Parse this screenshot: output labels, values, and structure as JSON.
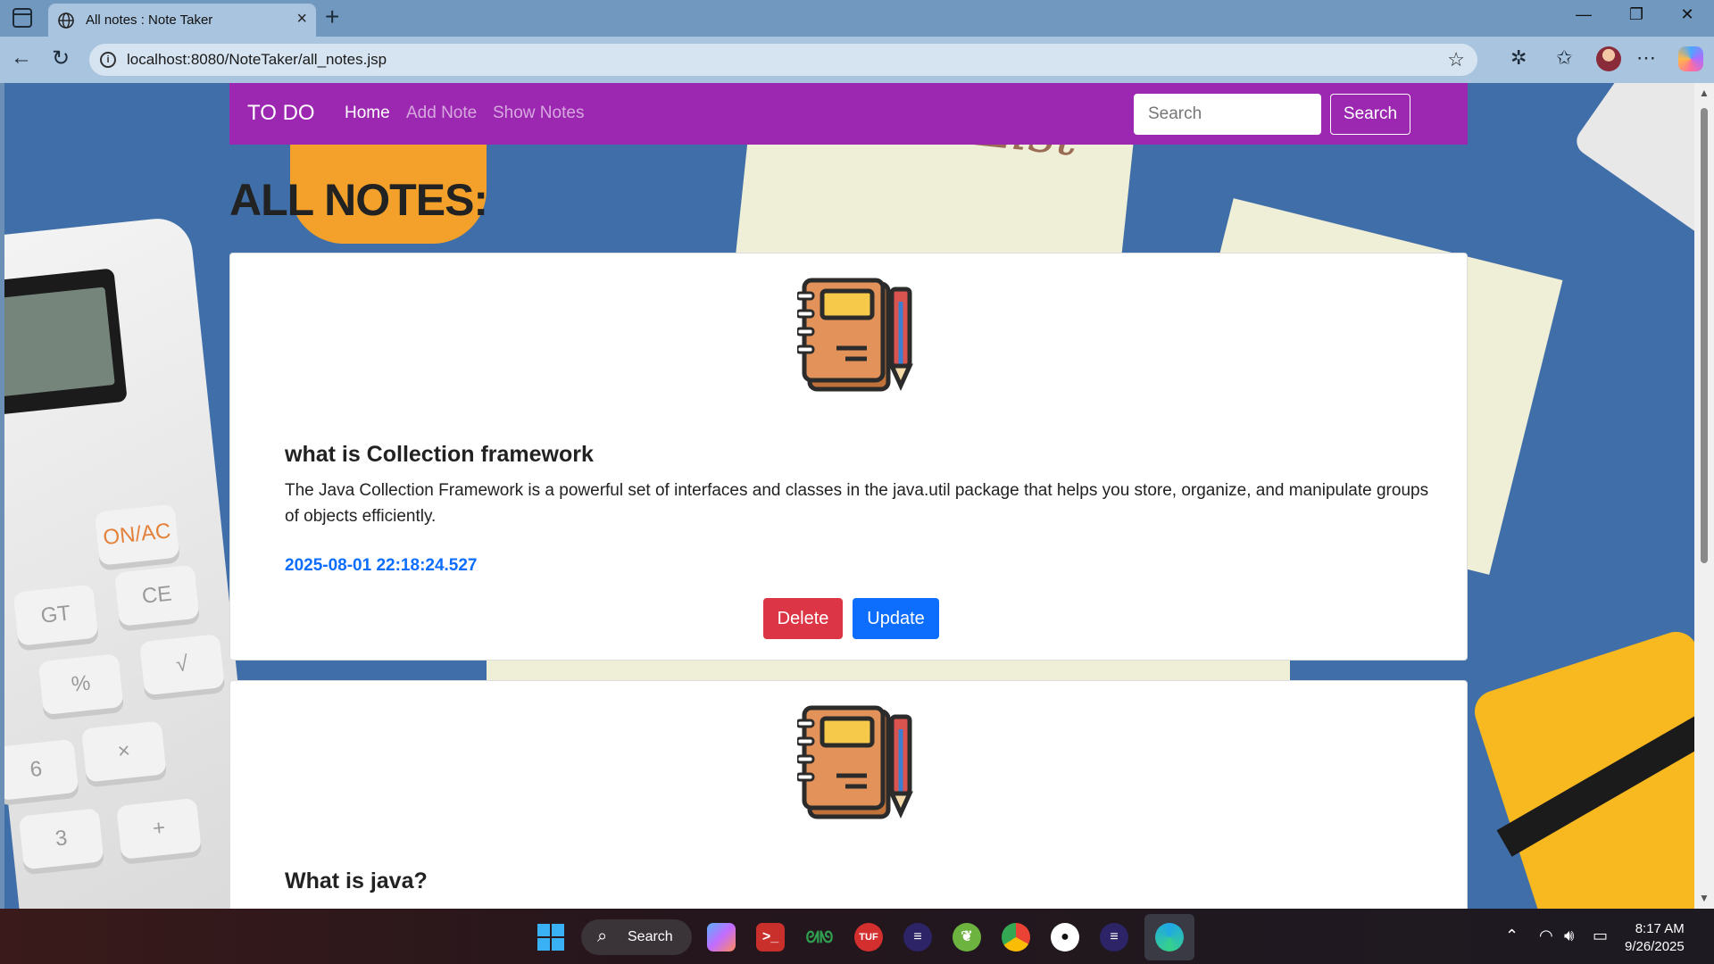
{
  "browser": {
    "tab_title": "All notes : Note Taker",
    "url": "localhost:8080/NoteTaker/all_notes.jsp"
  },
  "navbar": {
    "brand": "TO DO",
    "links": [
      "Home",
      "Add Note",
      "Show Notes"
    ],
    "search_placeholder": "Search",
    "search_button": "Search",
    "color": "#9c27b0"
  },
  "page": {
    "heading": "ALL NOTES:"
  },
  "notes": [
    {
      "title": "what is Collection framework",
      "content": "The Java Collection Framework is a powerful set of interfaces and classes in the java.util package that helps you store, organize, and manipulate groups of objects efficiently.",
      "date": "2025-08-01 22:18:24.527",
      "delete_label": "Delete",
      "update_label": "Update"
    },
    {
      "title": "What is java?"
    }
  ],
  "background": {
    "calc_keys": [
      "ON/AC",
      "GT",
      "CE",
      "%",
      "√",
      "×",
      "6",
      "3",
      "+"
    ],
    "note_text": "To Do List"
  },
  "taskbar": {
    "search_label": "Search",
    "time": "8:17 AM",
    "date": "9/26/2025"
  },
  "colors": {
    "delete": "#dc3545",
    "update": "#0d6efd",
    "date_text": "#0d6efd"
  }
}
